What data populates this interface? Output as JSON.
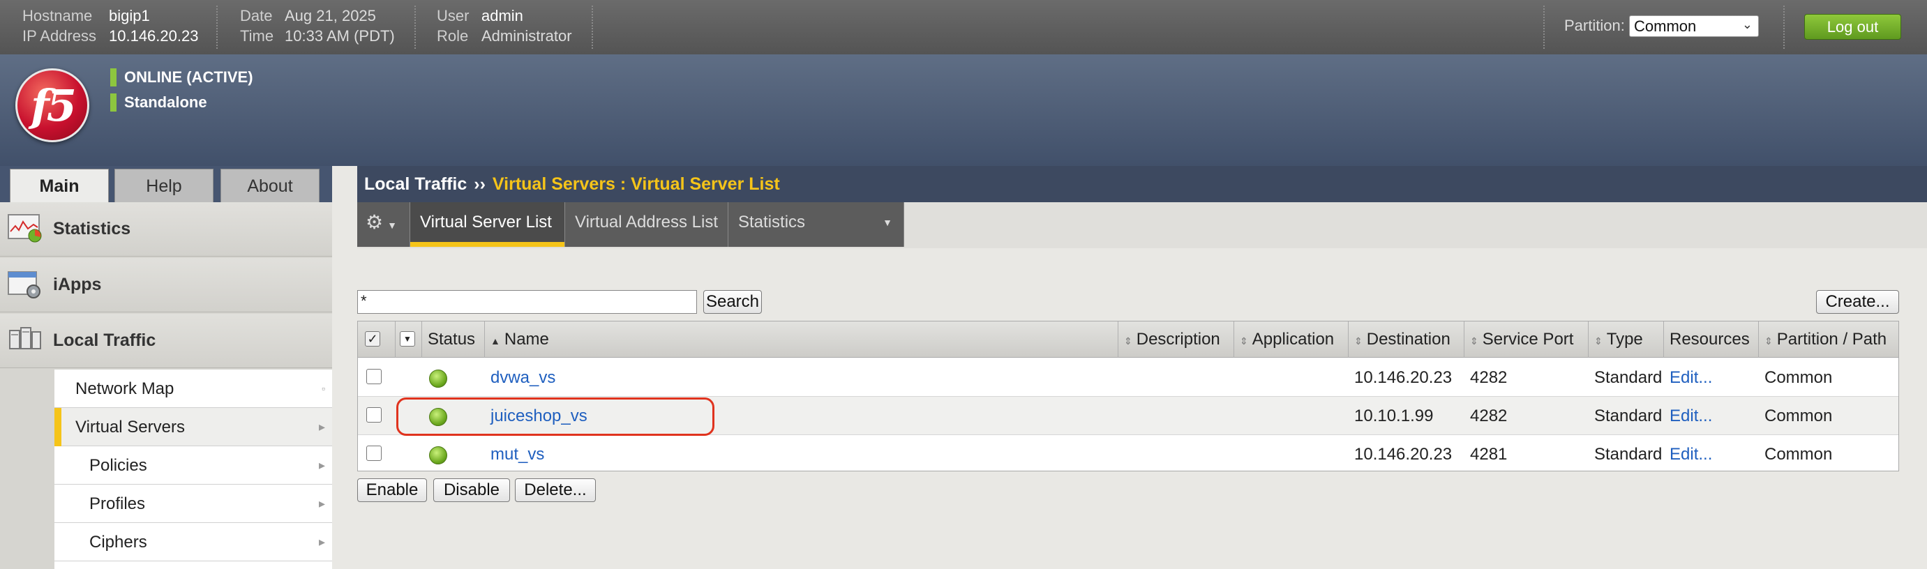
{
  "topbar": {
    "hostname_label": "Hostname",
    "hostname": "bigip1",
    "ip_label": "IP Address",
    "ip": "10.146.20.23",
    "date_label": "Date",
    "date": "Aug 21, 2025",
    "time_label": "Time",
    "time": "10:33 AM (PDT)",
    "user_label": "User",
    "user": "admin",
    "role_label": "Role",
    "role": "Administrator",
    "partition_label": "Partition:",
    "partition_value": "Common",
    "logout_label": "Log out"
  },
  "header": {
    "logo_text": "f5",
    "status_online": "ONLINE (ACTIVE)",
    "status_mode": "Standalone",
    "status_color": "#8dc63f"
  },
  "tabs": [
    {
      "label": "Main",
      "active": true
    },
    {
      "label": "Help",
      "active": false
    },
    {
      "label": "About",
      "active": false
    }
  ],
  "sidebar": {
    "sections": [
      {
        "label": "Statistics",
        "icon": "statistics-icon"
      },
      {
        "label": "iApps",
        "icon": "iapps-icon"
      },
      {
        "label": "Local Traffic",
        "icon": "local-traffic-icon"
      }
    ],
    "subitems": [
      {
        "label": "Network Map",
        "indent": false
      },
      {
        "label": "Virtual Servers",
        "indent": false,
        "active": true
      },
      {
        "label": "Policies",
        "indent": true
      },
      {
        "label": "Profiles",
        "indent": true
      },
      {
        "label": "Ciphers",
        "indent": true
      }
    ]
  },
  "breadcrumb": {
    "section": "Local Traffic",
    "separator": "››",
    "current": "Virtual Servers : Virtual Server List"
  },
  "subtabs": [
    {
      "label": "Virtual Server List",
      "active": true
    },
    {
      "label": "Virtual Address List",
      "active": false
    },
    {
      "label": "Statistics",
      "active": false
    }
  ],
  "search": {
    "value": "*",
    "button": "Search"
  },
  "create_label": "Create...",
  "table": {
    "headers": [
      "Status",
      "Name",
      "Description",
      "Application",
      "Destination",
      "Service Port",
      "Type",
      "Resources",
      "Partition / Path"
    ],
    "rows": [
      {
        "name": "dvwa_vs",
        "description": "",
        "application": "",
        "destination": "10.146.20.23",
        "port": "4282",
        "type": "Standard",
        "resources": "Edit...",
        "partition": "Common"
      },
      {
        "name": "juiceshop_vs",
        "description": "",
        "application": "",
        "destination": "10.10.1.99",
        "port": "4282",
        "type": "Standard",
        "resources": "Edit...",
        "partition": "Common"
      },
      {
        "name": "mut_vs",
        "description": "",
        "application": "",
        "destination": "10.146.20.23",
        "port": "4281",
        "type": "Standard",
        "resources": "Edit...",
        "partition": "Common"
      }
    ]
  },
  "actions": {
    "enable": "Enable",
    "disable": "Disable",
    "delete": "Delete..."
  },
  "colors": {
    "accent": "#f5c419",
    "highlight": "#e0331e",
    "link": "#1f5fbf"
  }
}
